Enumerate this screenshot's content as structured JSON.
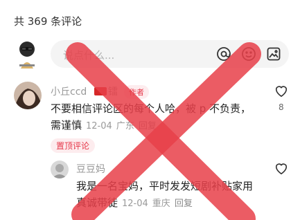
{
  "header": {
    "title": "共 369 条评论"
  },
  "composer": {
    "placeholder": "说点什么..."
  },
  "comments": [
    {
      "name": "小丘ccd",
      "badge": "作者",
      "text_line1": "不要相信评论区的每个人哈，被 p 不负责，",
      "text_line2": "需谨慎",
      "date": "12-04",
      "location": "广东",
      "reply": "回复",
      "pin": "置顶评论",
      "likes": "8"
    },
    {
      "name": "豆豆妈",
      "text_line1": "我是一名宝妈，平时发发短剧补贴家用",
      "text_line2": "真诚带徒",
      "date": "12-04",
      "location": "重庆",
      "reply": "回复"
    }
  ],
  "colors": {
    "accent": "#e6394a",
    "overlay": "#e8404a"
  }
}
